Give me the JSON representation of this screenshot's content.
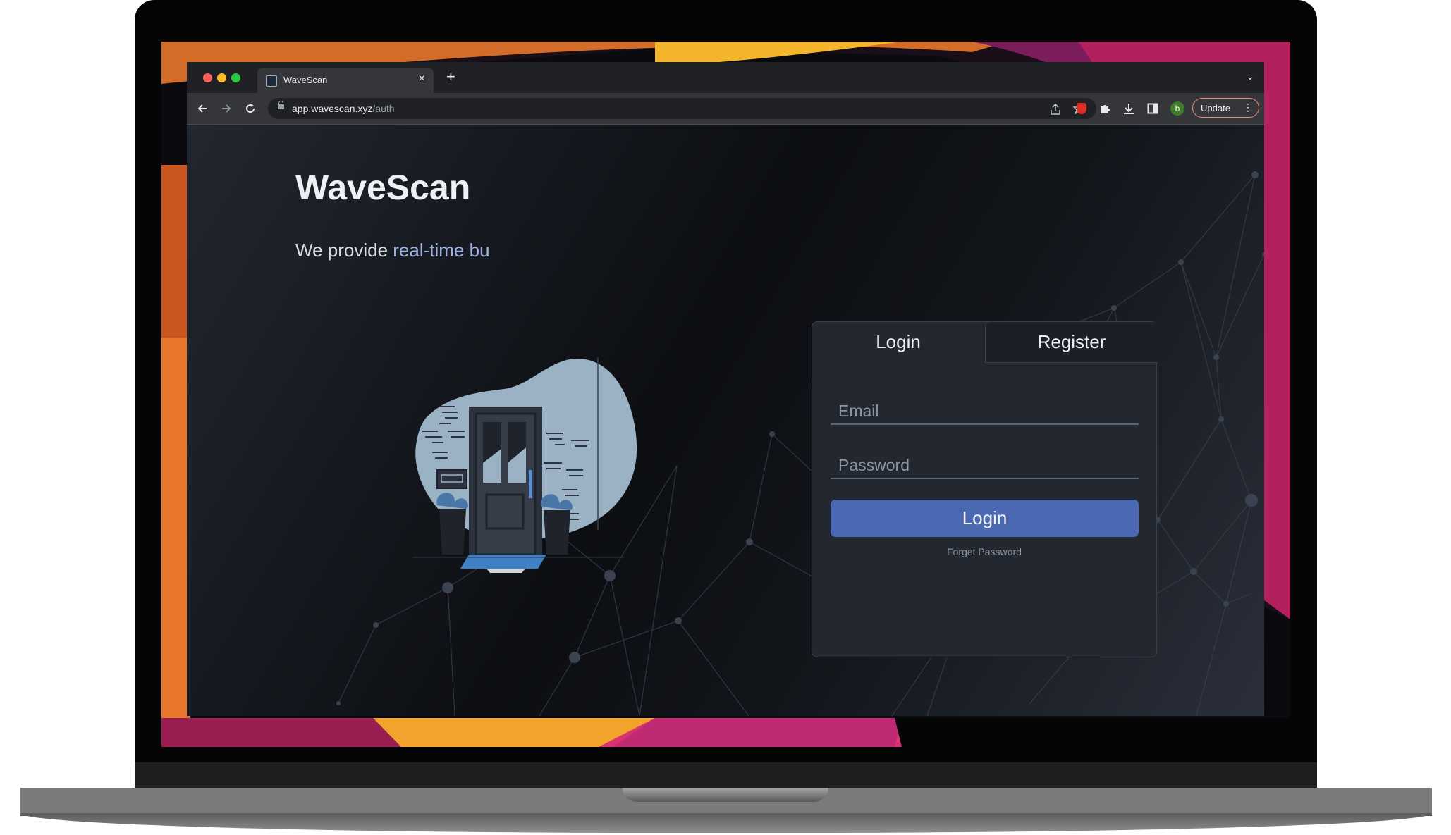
{
  "browser": {
    "tab_title": "WaveScan",
    "tab_close_glyph": "×",
    "new_tab_glyph": "+",
    "tab_menu_glyph": "⌄",
    "url_host": "app.wavescan.xyz",
    "url_path": "/auth",
    "update_label": "Update",
    "update_menu_glyph": "⋮",
    "profile_initial": "b",
    "icons": [
      "back-icon",
      "forward-icon",
      "reload-icon",
      "lock-icon",
      "share-icon",
      "bookmark-star-icon",
      "extension-shield-icon",
      "puzzle-icon",
      "download-icon",
      "side-panel-icon"
    ]
  },
  "page": {
    "brand": "WaveScan",
    "tagline_prefix": "We provide ",
    "tagline_highlight": "real-time bu"
  },
  "auth": {
    "tabs": [
      {
        "label": "Login",
        "active": true
      },
      {
        "label": "Register",
        "active": false
      }
    ],
    "email_placeholder": "Email",
    "password_placeholder": "Password",
    "login_button": "Login",
    "forget_password": "Forget Password"
  },
  "colors": {
    "accent": "#4b68b2",
    "highlight": "#9fb3e3",
    "update_border": "#f28b82"
  }
}
